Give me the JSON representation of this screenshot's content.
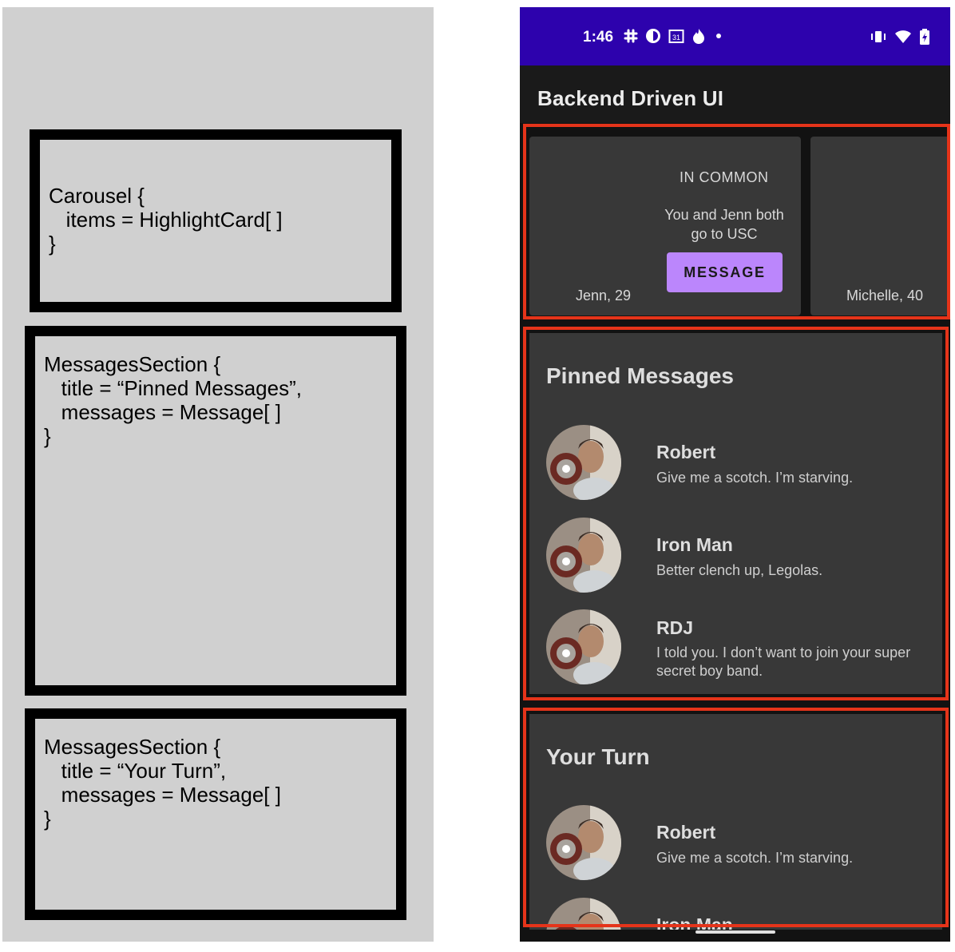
{
  "diagram": {
    "carousel_code": "Carousel {\n   items = HighlightCard[ ]\n}",
    "pinned_code": "MessagesSection {\n   title = “Pinned Messages”,\n   messages = Message[ ]\n}",
    "yourturn_code": "MessagesSection {\n   title = “Your Turn”,\n   messages = Message[ ]\n}"
  },
  "status_bar": {
    "time": "1:46",
    "calendar_day": "31",
    "left_icons": [
      "slack-icon",
      "app-icon",
      "calendar-icon",
      "flame-icon",
      "dot-icon"
    ],
    "right_icons": [
      "vibrate-icon",
      "wifi-icon",
      "battery-charging-icon"
    ]
  },
  "app_bar": {
    "title": "Backend Driven UI"
  },
  "carousel": {
    "cards": [
      {
        "name": "Jenn, 29",
        "tag": "IN COMMON",
        "detail": "You and Jenn both go to USC",
        "button": "MESSAGE"
      },
      {
        "name": "Michelle, 40"
      }
    ]
  },
  "pinned": {
    "title": "Pinned Messages",
    "messages": [
      {
        "name": "Robert",
        "text": "Give me a scotch. I’m starving."
      },
      {
        "name": "Iron Man",
        "text": "Better clench up, Legolas."
      },
      {
        "name": "RDJ",
        "text": "I told you. I don’t want to join your super secret boy band."
      }
    ]
  },
  "your_turn": {
    "title": "Your Turn",
    "messages": [
      {
        "name": "Robert",
        "text": "Give me a scotch. I’m starving."
      },
      {
        "name": "Iron Man",
        "text": ""
      }
    ]
  },
  "colors": {
    "status_bar": "#2d02ad",
    "accent_button": "#bb86fc",
    "outline": "#e5341a",
    "card": "#383838",
    "background": "#121212"
  }
}
